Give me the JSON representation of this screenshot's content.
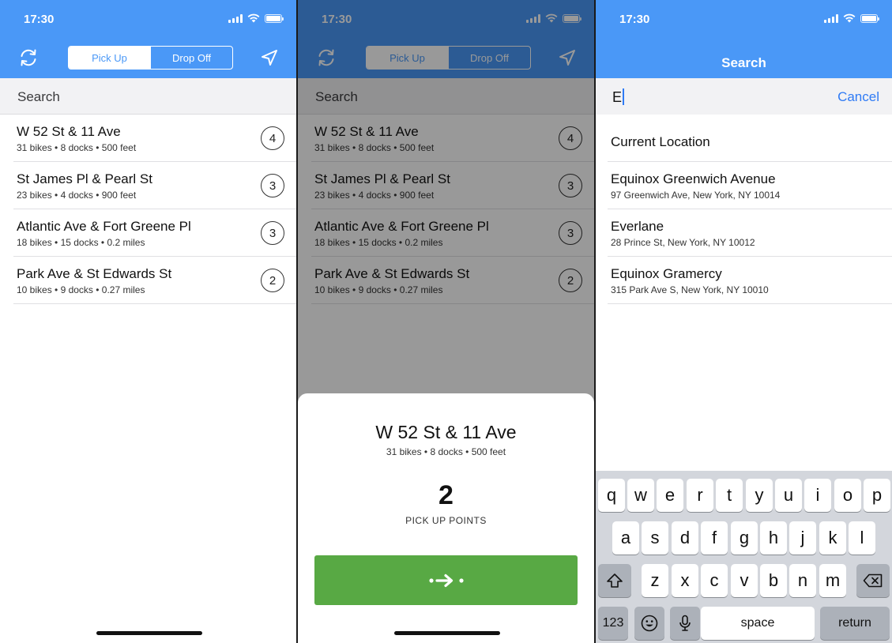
{
  "status": {
    "time": "17:30"
  },
  "segments": {
    "pickup": "Pick Up",
    "dropoff": "Drop Off"
  },
  "search_placeholder": "Search",
  "stations": [
    {
      "name": "W 52 St & 11 Ave",
      "details": "31 bikes • 8 docks • 500 feet",
      "count": "4"
    },
    {
      "name": "St James Pl & Pearl St",
      "details": "23 bikes • 4 docks • 900 feet",
      "count": "3"
    },
    {
      "name": "Atlantic Ave & Fort Greene Pl",
      "details": "18 bikes • 15 docks • 0.2 miles",
      "count": "3"
    },
    {
      "name": "Park Ave & St Edwards St",
      "details": "10 bikes • 9 docks • 0.27 miles",
      "count": "2"
    }
  ],
  "sheet": {
    "title": "W 52 St & 11 Ave",
    "subtitle": "31 bikes • 8 docks • 500 feet",
    "count": "2",
    "label": "PICK UP POINTS",
    "button_color": "#58a944"
  },
  "search_screen": {
    "title": "Search",
    "typed": "E",
    "cancel": "Cancel",
    "current_location": "Current Location",
    "results": [
      {
        "name": "Equinox Greenwich Avenue",
        "address": "97 Greenwich Ave, New York, NY 10014"
      },
      {
        "name": "Everlane",
        "address": "28 Prince St, New York, NY 10012"
      },
      {
        "name": "Equinox Gramercy",
        "address": "315 Park Ave S, New York, NY 10010"
      }
    ]
  },
  "keyboard": {
    "row1": [
      "q",
      "w",
      "e",
      "r",
      "t",
      "y",
      "u",
      "i",
      "o",
      "p"
    ],
    "row2": [
      "a",
      "s",
      "d",
      "f",
      "g",
      "h",
      "j",
      "k",
      "l"
    ],
    "row3": [
      "z",
      "x",
      "c",
      "v",
      "b",
      "n",
      "m"
    ],
    "numbers": "123",
    "space": "space",
    "return": "return"
  },
  "icons": [
    "refresh-icon",
    "location-arrow-icon",
    "shift-icon",
    "delete-icon",
    "emoji-icon",
    "mic-icon",
    "arrow-right-icon"
  ],
  "colors": {
    "header": "#4a98f7",
    "accent": "#2f7bf5",
    "go_button": "#58a944"
  }
}
